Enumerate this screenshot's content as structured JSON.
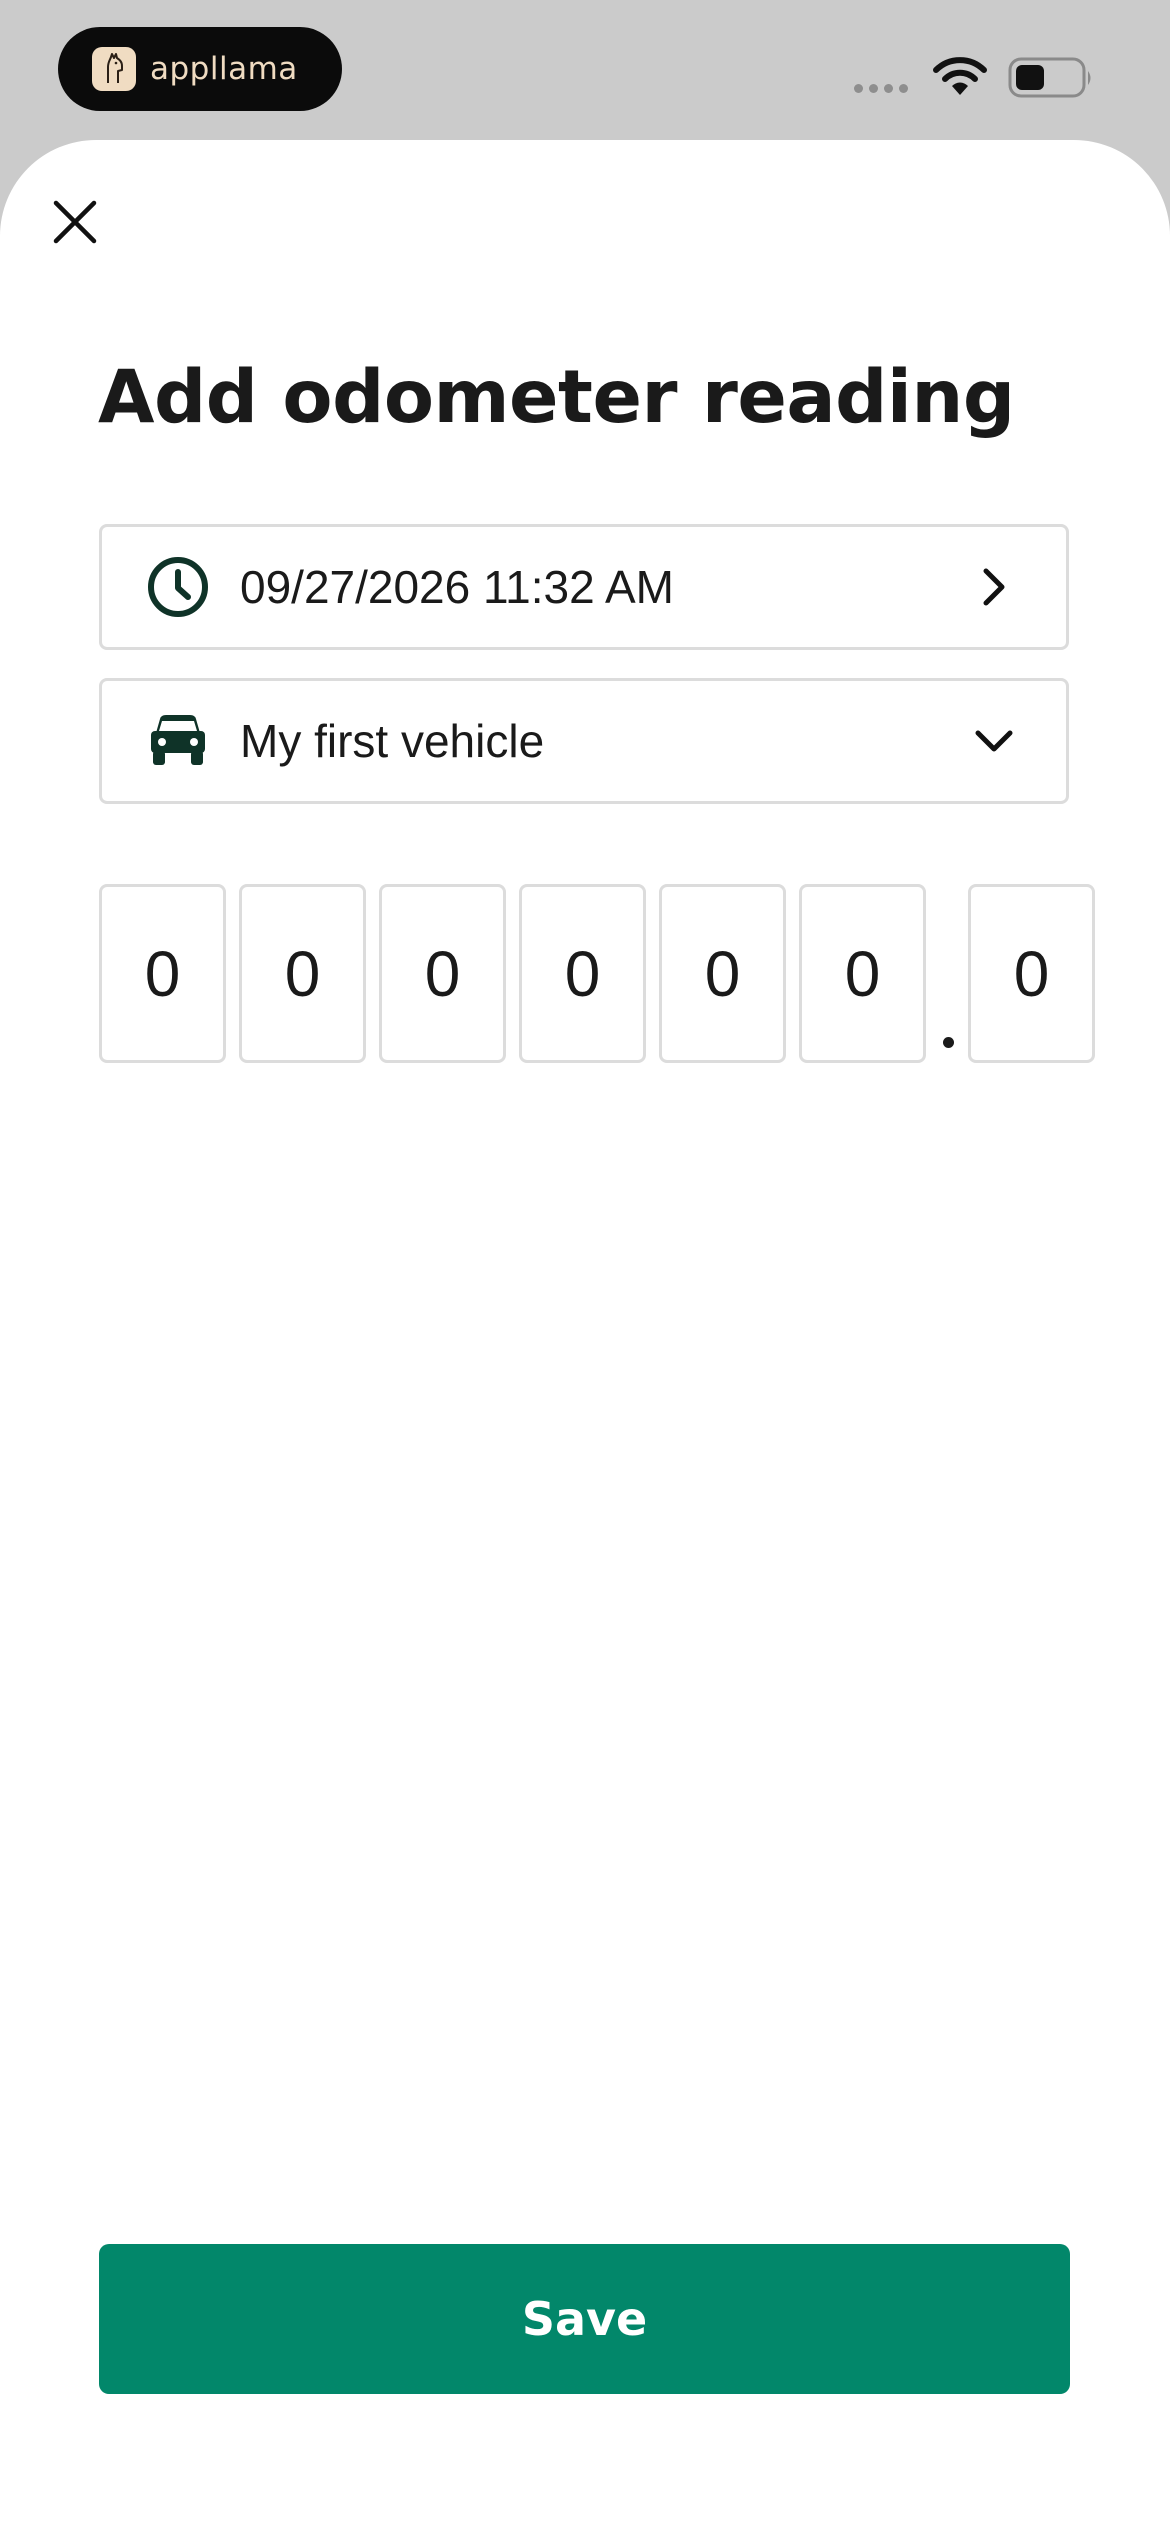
{
  "status_bar": {
    "brand_name": "appllama",
    "brand_logo_icon": "llama-logo-icon",
    "wifi_icon": "wifi-icon",
    "battery_icon": "battery-icon",
    "battery_level": 0.45
  },
  "sheet": {
    "close_icon": "close-icon",
    "title": "Add odometer reading"
  },
  "fields": {
    "datetime": {
      "icon": "clock-icon",
      "value": "09/27/2026 11:32 AM",
      "chevron_icon": "chevron-right-icon"
    },
    "vehicle": {
      "icon": "car-icon",
      "value": "My first vehicle",
      "chevron_icon": "chevron-down-icon"
    }
  },
  "odometer": {
    "integer_digits": [
      "0",
      "0",
      "0",
      "0",
      "0",
      "0"
    ],
    "decimal_digit": "0"
  },
  "actions": {
    "save_label": "Save"
  },
  "colors": {
    "accent": "#02876a",
    "icon_dark": "#0f3328",
    "border": "#dcdcdc",
    "status_background": "#cbcbcb"
  }
}
